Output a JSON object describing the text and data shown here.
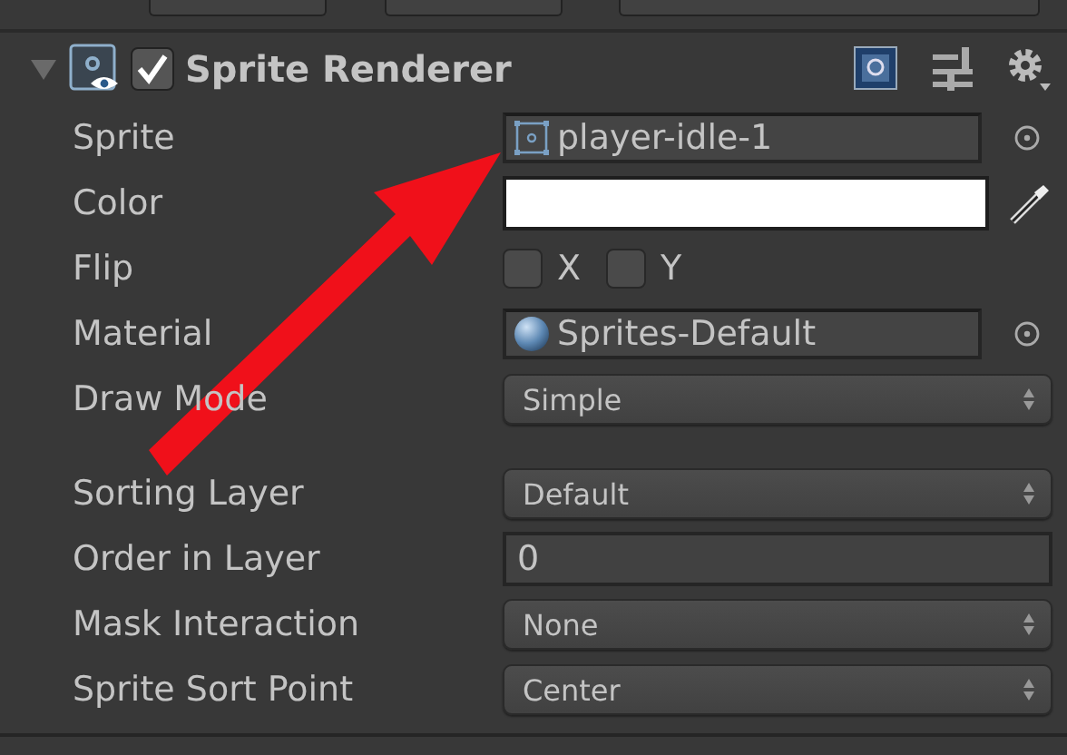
{
  "component": {
    "title": "Sprite Renderer",
    "enabled": true,
    "expanded": true
  },
  "rows": [
    {
      "kind": "sprite",
      "label": "Sprite",
      "value": "player-idle-1"
    },
    {
      "kind": "color",
      "label": "Color",
      "color": "#ffffff"
    },
    {
      "kind": "flip",
      "label": "Flip",
      "options": [
        {
          "label": "X",
          "checked": false
        },
        {
          "label": "Y",
          "checked": false
        }
      ]
    },
    {
      "kind": "material",
      "label": "Material",
      "value": "Sprites-Default"
    },
    {
      "kind": "dropdown",
      "label": "Draw Mode",
      "value": "Simple"
    },
    {
      "kind": "spacer"
    },
    {
      "kind": "dropdown",
      "label": "Sorting Layer",
      "value": "Default"
    },
    {
      "kind": "number",
      "label": "Order in Layer",
      "value": "0"
    },
    {
      "kind": "dropdown",
      "label": "Mask Interaction",
      "value": "None"
    },
    {
      "kind": "dropdown",
      "label": "Sprite Sort Point",
      "value": "Center"
    }
  ],
  "annotation": {
    "kind": "arrow"
  }
}
